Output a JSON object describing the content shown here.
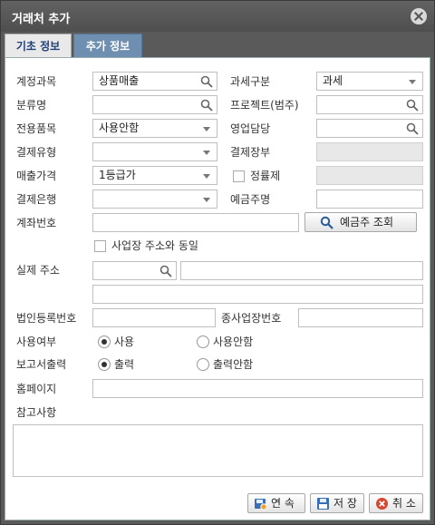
{
  "window": {
    "title": "거래처 추가"
  },
  "tabs": [
    {
      "label": "기초 정보"
    },
    {
      "label": "추가 정보"
    }
  ],
  "form": {
    "account": {
      "label": "계정과목",
      "value": "상품매출"
    },
    "tax_type": {
      "label": "과세구분",
      "value": "과세"
    },
    "category": {
      "label": "분류명",
      "value": ""
    },
    "project": {
      "label": "프로젝트(범주)",
      "value": ""
    },
    "dedicated_item": {
      "label": "전용품목",
      "value": "사용안함"
    },
    "sales_rep": {
      "label": "영업담당",
      "value": ""
    },
    "payment_type": {
      "label": "결제유형",
      "value": ""
    },
    "payment_ledger": {
      "label": "결제장부",
      "value": ""
    },
    "sales_price": {
      "label": "매출가격",
      "value": "1등급가"
    },
    "fixed_rate": {
      "label": "정률제",
      "checked": false,
      "value": ""
    },
    "payment_bank": {
      "label": "결제은행",
      "value": ""
    },
    "depositor": {
      "label": "예금주명",
      "value": ""
    },
    "account_number": {
      "label": "계좌번호",
      "value": ""
    },
    "depositor_lookup": {
      "label": "예금주 조회"
    },
    "same_as_business": {
      "label": "사업장 주소와 동일",
      "checked": false
    },
    "address": {
      "label": "실제 주소",
      "zip": "",
      "line1": "",
      "line2": ""
    },
    "corp_reg_no": {
      "label": "법인등록번호",
      "value": ""
    },
    "sub_business_no": {
      "label": "종사업장번호",
      "value": ""
    },
    "use_status": {
      "label": "사용여부",
      "options": [
        "사용",
        "사용안함"
      ],
      "selected": "사용"
    },
    "report_output": {
      "label": "보고서출력",
      "options": [
        "출력",
        "출력안함"
      ],
      "selected": "출력"
    },
    "homepage": {
      "label": "홈페이지",
      "value": ""
    },
    "notes": {
      "label": "참고사항",
      "value": ""
    }
  },
  "footer": {
    "continue_label": "연 속",
    "save_label": "저 장",
    "cancel_label": "취 소"
  },
  "colors": {
    "titlebar": "#555555",
    "active_tab": "#6e8fb0",
    "tab_text": "#1f3f78",
    "cancel_icon": "#d9452e"
  }
}
